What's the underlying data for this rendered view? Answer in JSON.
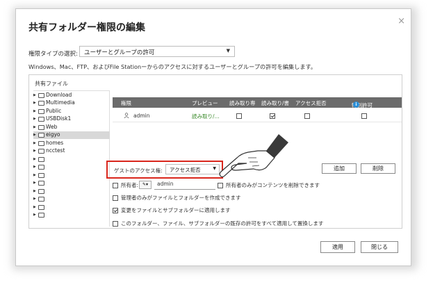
{
  "dialog": {
    "title": "共有フォルダー権限の編集",
    "close_label": "×",
    "perm_type_label": "権限タイプの選択:",
    "perm_type_value": "ユーザーとグループの許可",
    "description": "Windows、Mac、FTP、およびFile Stationーからのアクセスに対するユーザーとグループの許可を編集します。"
  },
  "panel": {
    "label": "共有ファイル",
    "tree": [
      {
        "label": "Download",
        "expander": "▶",
        "selected": false
      },
      {
        "label": "Multimedia",
        "expander": "▶",
        "selected": false
      },
      {
        "label": "Public",
        "expander": "▶",
        "selected": false
      },
      {
        "label": "USBDisk1",
        "expander": "▶",
        "selected": false
      },
      {
        "label": "Web",
        "expander": "▶",
        "selected": false
      },
      {
        "label": "eigyo",
        "expander": "▶",
        "selected": true
      },
      {
        "label": "homes",
        "expander": "▶",
        "selected": false
      },
      {
        "label": "ncctest",
        "expander": "▶",
        "selected": false
      },
      {
        "label": "",
        "expander": "▶",
        "selected": false
      },
      {
        "label": "",
        "expander": "▶",
        "selected": false
      },
      {
        "label": "",
        "expander": "▶",
        "selected": false
      },
      {
        "label": "",
        "expander": "▶",
        "selected": false
      },
      {
        "label": "",
        "expander": "▶",
        "selected": false
      },
      {
        "label": "",
        "expander": "▶",
        "selected": false
      },
      {
        "label": "",
        "expander": "▶",
        "selected": false
      },
      {
        "label": "",
        "expander": "▶",
        "selected": false
      }
    ],
    "columns": {
      "perm": "権限",
      "preview": "プレビュー",
      "read_only": "読み取り専",
      "read_write": "読み取り/書",
      "deny": "アクセス拒否",
      "special": "特別許可",
      "info_icon": "i"
    },
    "rows": [
      {
        "user": "admin",
        "preview": "読み取り/...",
        "read_only": false,
        "read_write": true,
        "deny": false,
        "special": false
      }
    ],
    "guest_label": "ゲストのアクセス権:",
    "guest_value": "アクセス拒否",
    "add_label": "追加",
    "remove_label": "削除",
    "owner_label": "所有者:",
    "owner_value": "admin",
    "owner_button": "✎▾",
    "opt_owner_delete": "所有者のみがコンテンツを削除できます",
    "opt_admin_create": "管理者のみがファイルとフォルダーを作成できます",
    "opt_apply_changes": "変更をファイルとサブフォルダーに適用します",
    "opt_replace_all": "このフォルダー、ファイル、サブフォルダーの既存の許可をすべて適用して置換します"
  },
  "footer": {
    "apply_label": "適用",
    "close_label": "閉じる"
  },
  "colors": {
    "header_bg": "#6b6b6b",
    "highlight": "#d9261c",
    "preview_text": "#3a8a2a",
    "info_icon": "#2b8fd8"
  }
}
